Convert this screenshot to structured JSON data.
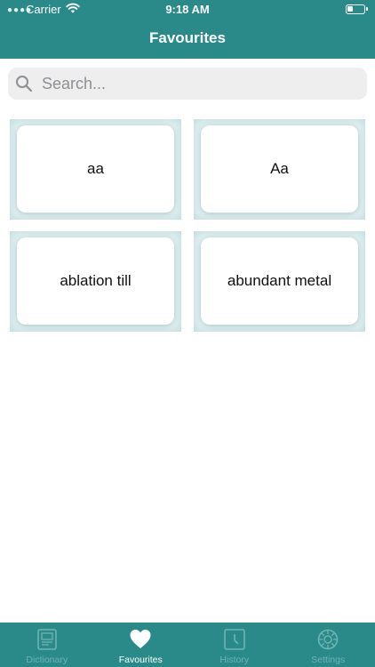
{
  "status_bar": {
    "carrier": "Carrier",
    "time": "9:18 AM"
  },
  "nav": {
    "title": "Favourites"
  },
  "search": {
    "placeholder": "Search..."
  },
  "cards": [
    {
      "label": "aa"
    },
    {
      "label": "Aa"
    },
    {
      "label": "ablation till"
    },
    {
      "label": "abundant metal"
    }
  ],
  "tabbar": {
    "items": [
      {
        "label": "Dictionary",
        "icon": "dictionary-icon",
        "active": false
      },
      {
        "label": "Favourites",
        "icon": "heart-icon",
        "active": true
      },
      {
        "label": "History",
        "icon": "clock-icon",
        "active": false
      },
      {
        "label": "Settings",
        "icon": "gear-icon",
        "active": false
      }
    ]
  },
  "colors": {
    "primary": "#2a8a8a",
    "inactive_tab": "#6fb3b3",
    "search_bg": "#eeeeef",
    "tile_bg": "#e8f3f4"
  }
}
